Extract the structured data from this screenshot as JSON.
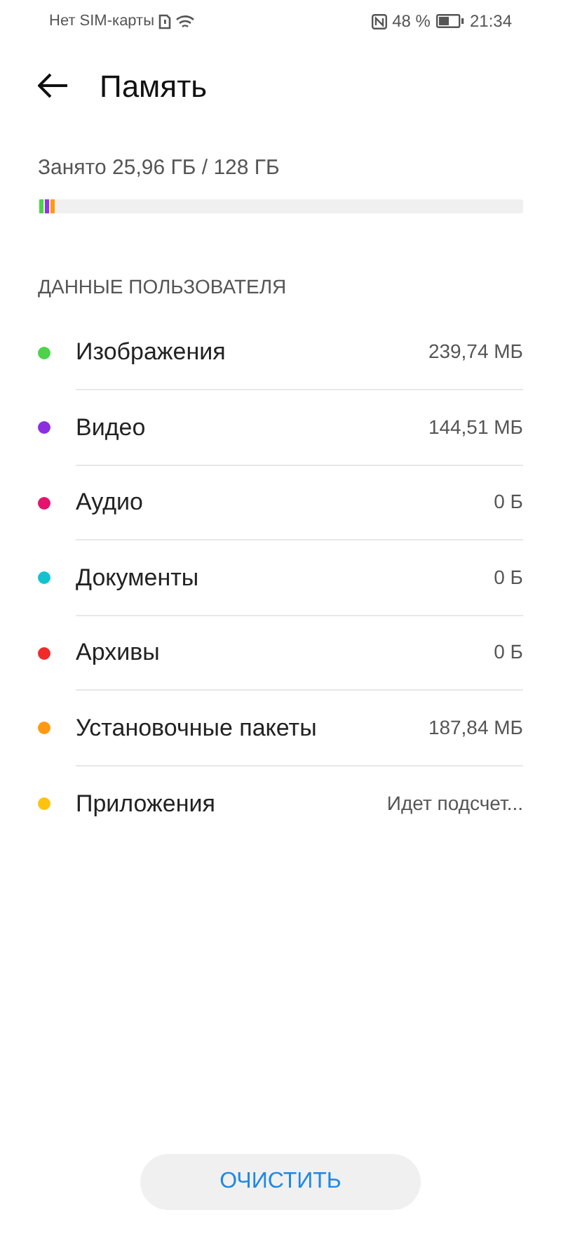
{
  "status_bar": {
    "carrier": "Нет SIM-карты",
    "battery": "48 %",
    "time": "21:34"
  },
  "header": {
    "title": "Память"
  },
  "storage": {
    "used_text": "Занято 25,96 ГБ / 128 ГБ",
    "segments": [
      {
        "color": "#4cd34a",
        "level": 0.009
      },
      {
        "color": "#9533e0",
        "level": 0.009
      },
      {
        "color": "#ff9a0e",
        "level": 0.009
      }
    ]
  },
  "section": {
    "title": "ДАННЫЕ ПОЛЬЗОВАТЕЛЯ"
  },
  "items": [
    {
      "label": "Изображения",
      "size": "239,74 МБ",
      "color": "#4cd34a"
    },
    {
      "label": "Видео",
      "size": "144,51 МБ",
      "color": "#8b2fe0"
    },
    {
      "label": "Аудио",
      "size": "0 Б",
      "color": "#e3146d"
    },
    {
      "label": "Документы",
      "size": "0 Б",
      "color": "#14c2cf"
    },
    {
      "label": "Архивы",
      "size": "0 Б",
      "color": "#f22a2a"
    },
    {
      "label": "Установочные пакеты",
      "size": "187,84 МБ",
      "color": "#ff9a0e"
    },
    {
      "label": "Приложения",
      "size": "Идет подсчет...",
      "color": "#ffc20e"
    }
  ],
  "clear_button": {
    "label": "ОЧИСТИТЬ"
  }
}
